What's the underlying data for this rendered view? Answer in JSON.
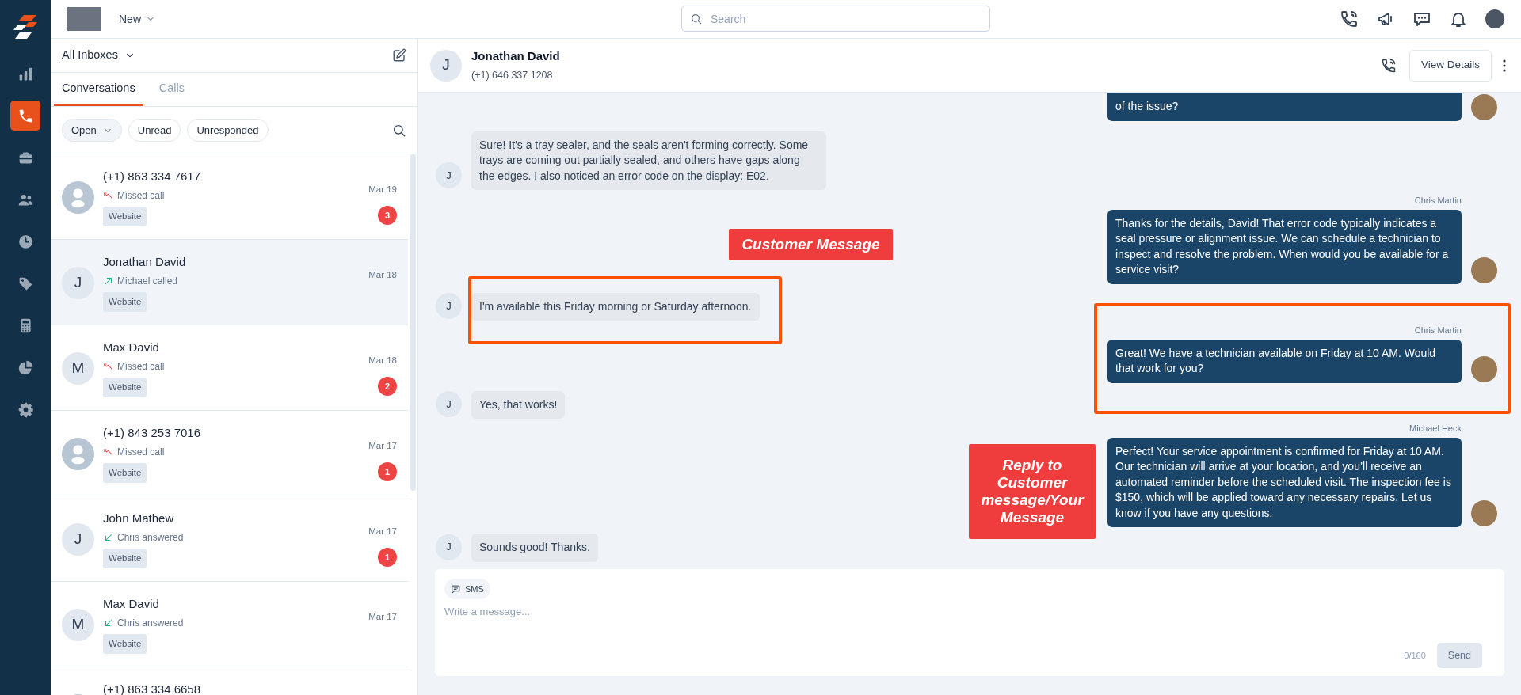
{
  "sidebar": {
    "items": [
      {
        "kind": "chart",
        "selected": false
      },
      {
        "kind": "phone",
        "selected": true
      },
      {
        "kind": "briefcase",
        "selected": false
      },
      {
        "kind": "users",
        "selected": false
      },
      {
        "kind": "clock",
        "selected": false
      },
      {
        "kind": "tag",
        "selected": false
      },
      {
        "kind": "calculator",
        "selected": false
      },
      {
        "kind": "pie",
        "selected": false
      },
      {
        "kind": "gear",
        "selected": false
      }
    ]
  },
  "topbar": {
    "workspace": "New",
    "search": {
      "placeholder": "Search"
    },
    "icons": [
      {
        "kind": "phone"
      },
      {
        "kind": "megaphone"
      },
      {
        "kind": "chat"
      },
      {
        "kind": "bell"
      },
      {
        "kind": "avatar"
      }
    ]
  },
  "inbox": {
    "title": "All Inboxes",
    "tabs": [
      {
        "label": "Conversations",
        "selected": true
      },
      {
        "label": "Calls",
        "selected": false
      }
    ],
    "filters": [
      {
        "label": "Open",
        "kind": "dropdown"
      },
      {
        "label": "Unread",
        "kind": "chip"
      },
      {
        "label": "Unresponded",
        "kind": "chip"
      }
    ],
    "conversations": [
      {
        "name": "(+1) 863 334 7617",
        "activity": "Missed call",
        "kind": "missed",
        "tag": "Website",
        "date": "Mar 19",
        "unread": "3",
        "selected": false
      },
      {
        "name": "Jonathan David",
        "avatar": "J",
        "activity": "Michael called",
        "kind": "outgoing",
        "tag": "Website",
        "date": "Mar 18",
        "selected": true
      },
      {
        "name": "Max David",
        "avatar": "M",
        "activity": "Missed call",
        "kind": "missed",
        "tag": "Website",
        "date": "Mar 18",
        "unread": "2",
        "selected": false
      },
      {
        "name": "(+1) 843 253 7016",
        "activity": "Missed call",
        "kind": "missed",
        "tag": "Website",
        "date": "Mar 17",
        "unread": "1",
        "selected": false
      },
      {
        "name": "John Mathew",
        "avatar": "J",
        "activity": "Chris answered",
        "kind": "incoming",
        "tag": "Website",
        "date": "Mar 17",
        "unread": "1",
        "selected": false
      },
      {
        "name": "Max David",
        "avatar": "M",
        "activity": "Chris answered",
        "kind": "incoming",
        "tag": "Website",
        "date": "Mar 17",
        "selected": false
      },
      {
        "name": "(+1) 863 334 6658",
        "selected": false
      }
    ]
  },
  "conversation": {
    "name": "Jonathan David",
    "phone": "(+1) 646 337 1208",
    "avatar": "J",
    "view_details": "View Details",
    "messages": [
      {
        "kind": "outgoing",
        "text": "of the issue?",
        "highlighted": false
      },
      {
        "kind": "incoming",
        "avatar": "J",
        "text": "Sure! It's a tray sealer, and the seals aren't forming correctly. Some trays are coming out partially sealed, and others have gaps along the edges. I also noticed an error code on the display: E02.",
        "highlighted": false
      },
      {
        "kind": "outgoing",
        "sender": "Chris Martin",
        "text": "Thanks for the details, David! That error code typically indicates a seal pressure or alignment issue. We can schedule a technician to inspect and resolve the problem. When would you be available for a service visit?",
        "highlighted": false
      },
      {
        "kind": "incoming",
        "avatar": "J",
        "text": "I'm available this Friday morning or Saturday afternoon.",
        "highlighted": true
      },
      {
        "kind": "outgoing",
        "sender": "Chris Martin",
        "text": "Great! We have a technician available on Friday at 10 AM. Would that work for you?",
        "highlighted": true
      },
      {
        "kind": "incoming",
        "avatar": "J",
        "text": "Yes, that works!",
        "highlighted": false
      },
      {
        "kind": "outgoing",
        "sender": "Michael Heck",
        "text": "Perfect! Your service appointment is confirmed for Friday at 10 AM. Our technician will arrive at your location, and you’ll receive an automated reminder before the scheduled visit. The inspection fee is $150, which will be applied toward any necessary repairs. Let us know if you have any questions.",
        "highlighted": false
      },
      {
        "kind": "incoming",
        "avatar": "J",
        "text": "Sounds good! Thanks.",
        "highlighted": false
      }
    ],
    "compose": {
      "channel": "SMS",
      "placeholder": "Write a message...",
      "counter": "0/160",
      "send": "Send"
    }
  },
  "annotations": [
    {
      "kind": "customer",
      "text": "Customer Message"
    },
    {
      "kind": "reply",
      "text": "Reply to Customer message/Your Message"
    }
  ]
}
